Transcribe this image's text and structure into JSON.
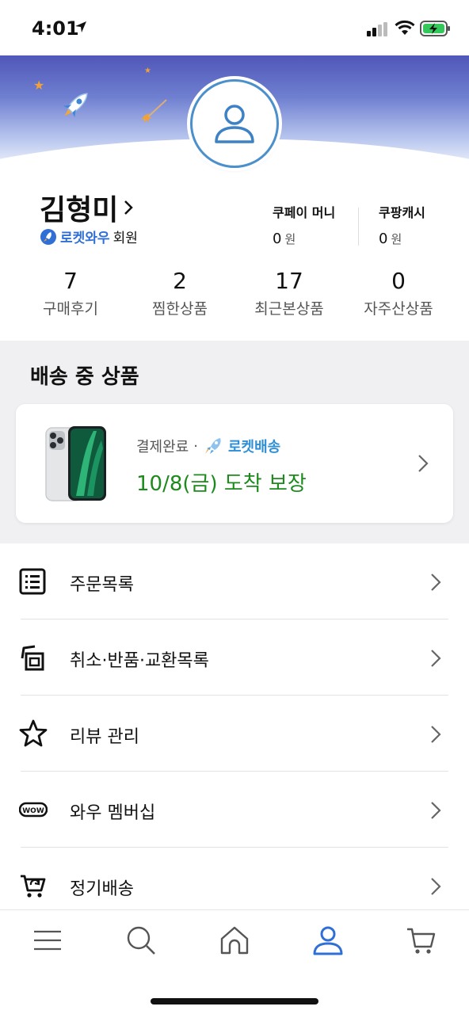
{
  "status_bar": {
    "time": "4:01"
  },
  "profile": {
    "name": "김형미",
    "membership_brand": "로켓와우",
    "membership_suffix": "회원",
    "coupay": {
      "label": "쿠페이 머니",
      "value": "0",
      "unit": "원"
    },
    "coupang_cash": {
      "label": "쿠팡캐시",
      "value": "0",
      "unit": "원"
    }
  },
  "stats": [
    {
      "value": "7",
      "label": "구매후기"
    },
    {
      "value": "2",
      "label": "찜한상품"
    },
    {
      "value": "17",
      "label": "최근본상품"
    },
    {
      "value": "0",
      "label": "자주산상품"
    }
  ],
  "delivery": {
    "section_title": "배송 중 상품",
    "order_status": "결제완료",
    "separator": "·",
    "shipping_type": "로켓배송",
    "arrival": "10/8(금) 도착 보장"
  },
  "menu": [
    {
      "label": "주문목록",
      "icon": "list-icon"
    },
    {
      "label": "취소·반품·교환목록",
      "icon": "return-icon"
    },
    {
      "label": "리뷰 관리",
      "icon": "star-icon"
    },
    {
      "label": "와우 멤버십",
      "icon": "wow-icon",
      "icon_text": "WOW"
    },
    {
      "label": "정기배송",
      "icon": "subscription-cart-icon"
    }
  ],
  "tabbar": [
    {
      "name": "menu",
      "icon": "hamburger-icon"
    },
    {
      "name": "search",
      "icon": "search-icon"
    },
    {
      "name": "home",
      "icon": "home-icon"
    },
    {
      "name": "my",
      "icon": "person-icon",
      "active": true
    },
    {
      "name": "cart",
      "icon": "cart-icon"
    }
  ],
  "colors": {
    "accent_blue": "#2f6fd6",
    "arrival_green": "#1e8a1e",
    "rocket_blue": "#2f8fd6",
    "section_gray": "#f0f0f2"
  }
}
